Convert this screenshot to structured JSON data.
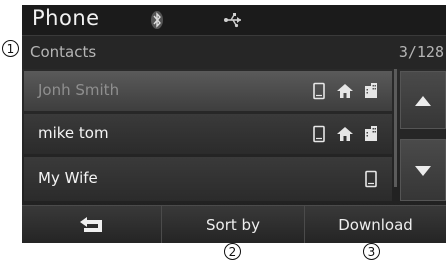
{
  "header": {
    "title": "Phone",
    "icons": [
      "bluetooth-icon",
      "usb-icon"
    ]
  },
  "contacts": {
    "label": "Contacts",
    "count": "3/128"
  },
  "list": [
    {
      "name": "Jonh Smith",
      "icons": [
        "mobile-icon",
        "home-icon",
        "office-icon"
      ],
      "selected": true
    },
    {
      "name": "mike tom",
      "icons": [
        "mobile-icon",
        "home-icon",
        "office-icon"
      ],
      "selected": false
    },
    {
      "name": "My Wife",
      "icons": [
        "mobile-icon"
      ],
      "selected": false
    }
  ],
  "bottom": {
    "back_icon": "return-arrow-icon",
    "sort_label": "Sort by",
    "download_label": "Download"
  },
  "callouts": [
    "1",
    "2",
    "3"
  ]
}
